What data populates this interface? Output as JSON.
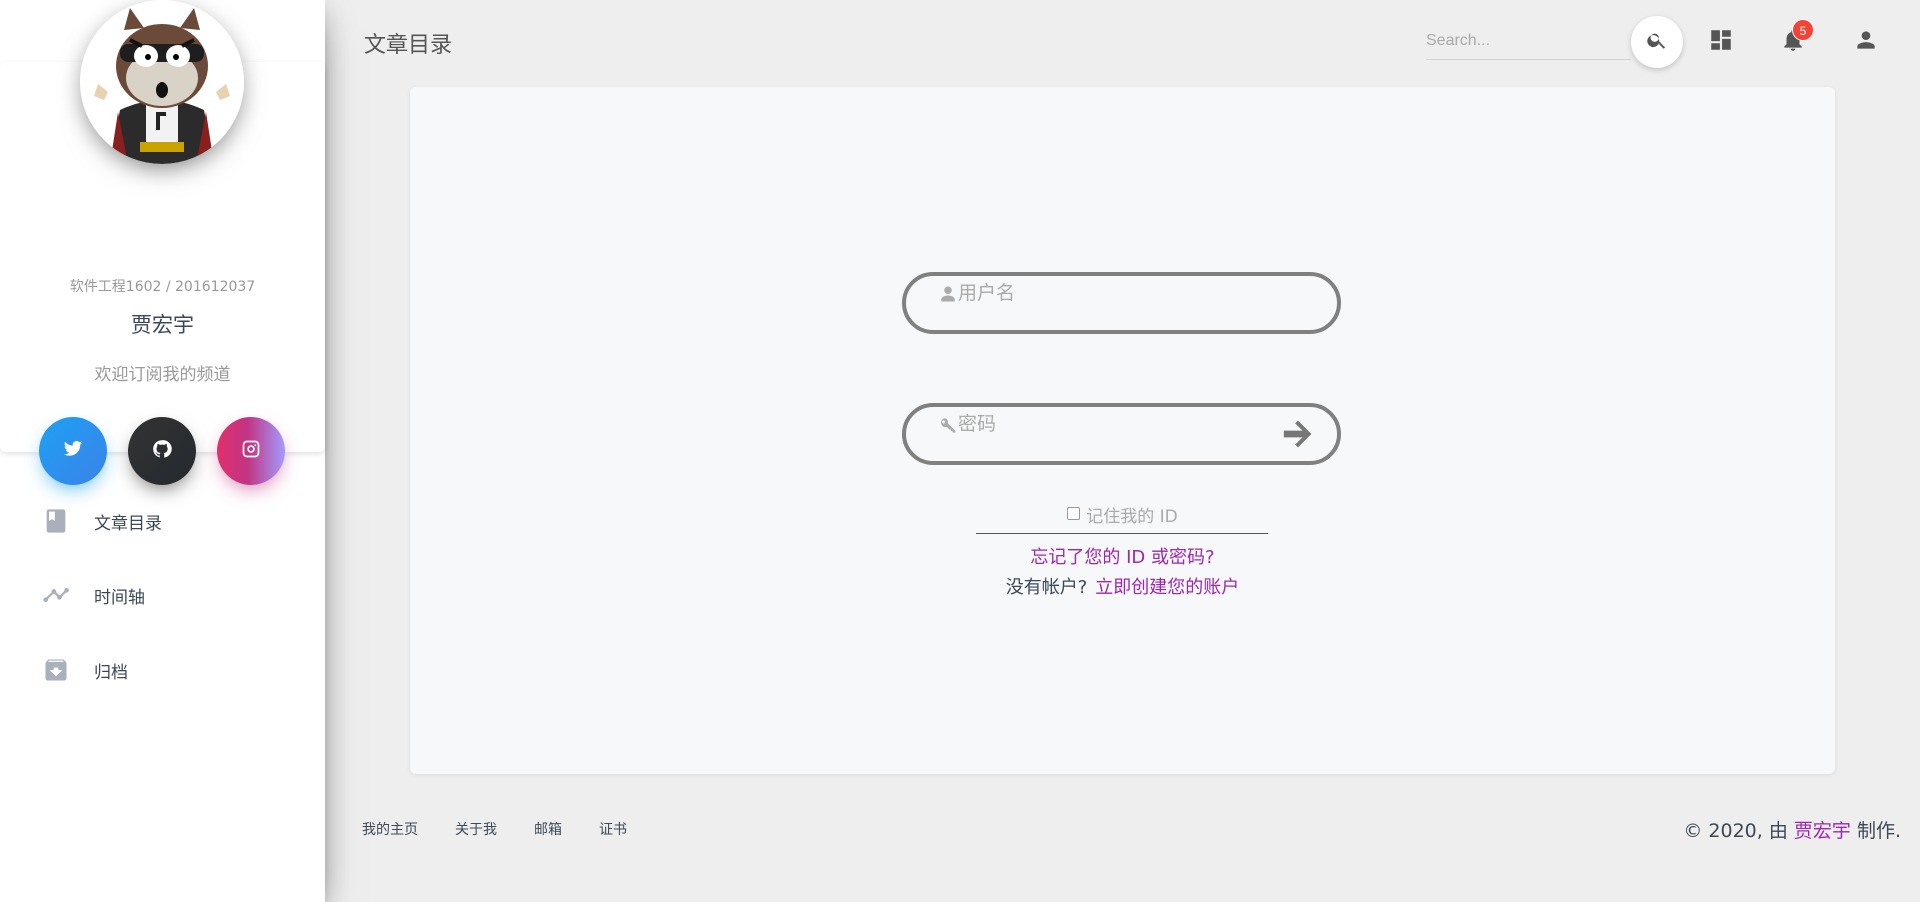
{
  "sidebar": {
    "profile": {
      "meta": "软件工程1602 / 201612037",
      "name": "贾宏宇",
      "description": "欢迎订阅我的频道"
    },
    "social": [
      {
        "icon": "twitter-icon"
      },
      {
        "icon": "github-icon"
      },
      {
        "icon": "instagram-icon"
      }
    ],
    "nav": [
      {
        "label": "文章目录",
        "icon": "book-icon"
      },
      {
        "label": "时间轴",
        "icon": "timeline-icon"
      },
      {
        "label": "归档",
        "icon": "archive-icon"
      }
    ]
  },
  "header": {
    "title": "文章目录",
    "search_placeholder": "Search...",
    "notification_count": "5"
  },
  "login": {
    "username_placeholder": "用户名",
    "password_placeholder": "密码",
    "remember_label": "记住我的 ID",
    "forgot_link": "忘记了您的 ID 或密码?",
    "no_account_text": "没有帐户?",
    "create_account_link": "立即创建您的账户"
  },
  "footer": {
    "links": [
      "我的主页",
      "关于我",
      "邮箱",
      "证书"
    ],
    "copyright_prefix": "© 2020, 由",
    "copyright_author": "贾宏宇",
    "copyright_suffix": "制作."
  },
  "colors": {
    "accent": "#9c27b0",
    "badge": "#f44336",
    "twitter": "#1da1f2",
    "github": "#24292e",
    "instagram": "#c13584"
  }
}
